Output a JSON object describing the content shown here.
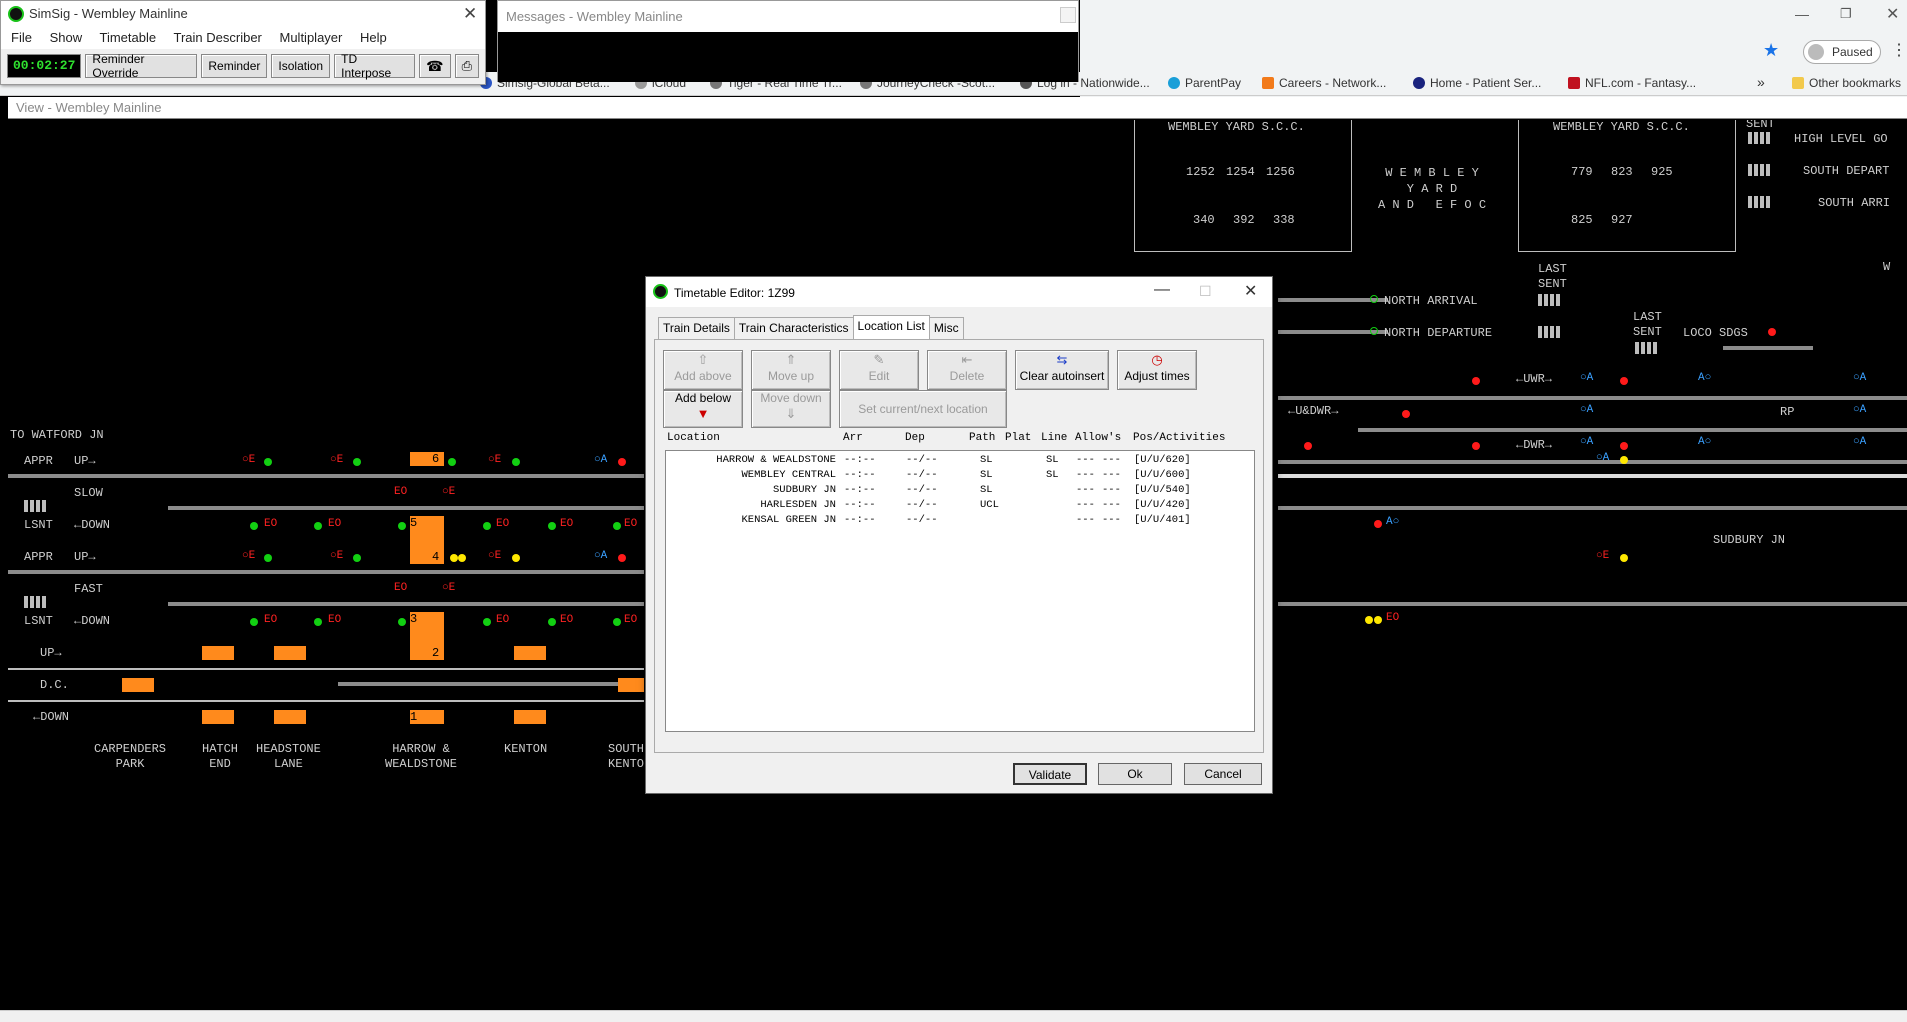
{
  "simsig": {
    "title": "SimSig - Wembley Mainline",
    "menu": [
      "File",
      "Show",
      "Timetable",
      "Train Describer",
      "Multiplayer",
      "Help"
    ],
    "clock": "00:02:27",
    "buttons": [
      "Reminder Override",
      "Reminder",
      "Isolation",
      "TD Interpose"
    ]
  },
  "messages": {
    "title": "Messages - Wembley Mainline"
  },
  "browser": {
    "paused_label": "Paused",
    "bookmarks": [
      "Simsig-Global Beta...",
      "iCloud",
      "Tiger - Real Time Tr...",
      "JourneyCheck -Scot...",
      "Log in - Nationwide...",
      "ParentPay",
      "Careers - Network...",
      "Home - Patient Ser...",
      "NFL.com - Fantasy...",
      "Other bookmarks"
    ],
    "more": "»"
  },
  "view": {
    "title": "View - Wembley Mainline"
  },
  "diagram": {
    "labels": {
      "watford": "TO WATFORD JN",
      "appr1": "APPR",
      "up1": "UP→",
      "slow": "SLOW",
      "lsnt1": "LSNT",
      "down1": "←DOWN",
      "appr2": "APPR",
      "up2": "UP→",
      "fast": "FAST",
      "lsnt2": "LSNT",
      "down2": "←DOWN",
      "up_dc": "UP→",
      "dc": "D.C.",
      "down_dc": "←DOWN",
      "north_arrival": "NORTH ARRIVAL",
      "north_departure": "NORTH DEPARTURE",
      "last_sent1": "LAST\nSENT",
      "last_sent2": "LAST\nSENT",
      "loco_sdgs": "LOCO SDGS",
      "sudbury_jn": "SUDBURY JN",
      "rp": "RP",
      "wembley_yard1": "WEMBLEY YARD S.C.C.",
      "wembley_yard2": "WEMBLEY YARD S.C.C.",
      "wembley_efoc": "W E M B L E Y\nY A R D\nA N D   E F O C",
      "sent": "SENT",
      "high_level": "HIGH LEVEL GO",
      "south_depart": "SOUTH DEPART",
      "south_arri": "SOUTH ARRI",
      "uwr": "←UWR→",
      "udwr": "←U&DWR→",
      "dwr": "←DWR→",
      "w_partial": "W"
    },
    "yard1_numbers": [
      "1252",
      "1254",
      "1256",
      "340",
      "392",
      "338"
    ],
    "yard2_numbers": [
      "779",
      "823",
      "925",
      "825",
      "927"
    ],
    "platforms": [
      "6",
      "5",
      "4",
      "3",
      "2",
      "1"
    ],
    "stations": [
      "CARPENDERS\nPARK",
      "HATCH\nEND",
      "HEADSTONE\nLANE",
      "HARROW &\nWEALDSTONE",
      "KENTON",
      "SOUTH\nKENTO"
    ]
  },
  "editor": {
    "title": "Timetable Editor: 1Z99",
    "tabs": [
      "Train Details",
      "Train Characteristics",
      "Location List",
      "Misc"
    ],
    "active_tab": "Location List",
    "buttons": {
      "add_above": "Add above",
      "move_up": "Move up",
      "edit": "Edit",
      "delete": "Delete",
      "clear_autoinsert": "Clear autoinsert",
      "adjust_times": "Adjust times",
      "add_below": "Add below",
      "move_down": "Move down",
      "set_current": "Set current/next location"
    },
    "columns": [
      "Location",
      "Arr",
      "Dep",
      "Path",
      "Plat",
      "Line",
      "Allow's",
      "Pos/Activities"
    ],
    "rows": [
      {
        "location": "HARROW & WEALDSTONE",
        "arr": "--:--",
        "dep": "--/--",
        "path": "SL",
        "plat": "",
        "line": "SL",
        "allow1": "---",
        "allow2": "---",
        "pos": "[U/U/620]"
      },
      {
        "location": "WEMBLEY CENTRAL",
        "arr": "--:--",
        "dep": "--/--",
        "path": "SL",
        "plat": "",
        "line": "SL",
        "allow1": "---",
        "allow2": "---",
        "pos": "[U/U/600]"
      },
      {
        "location": "SUDBURY JN",
        "arr": "--:--",
        "dep": "--/--",
        "path": "SL",
        "plat": "",
        "line": "",
        "allow1": "---",
        "allow2": "---",
        "pos": "[U/U/540]"
      },
      {
        "location": "HARLESDEN JN",
        "arr": "--:--",
        "dep": "--/--",
        "path": "UCL",
        "plat": "",
        "line": "",
        "allow1": "---",
        "allow2": "---",
        "pos": "[U/U/420]"
      },
      {
        "location": "KENSAL GREEN JN",
        "arr": "--:--",
        "dep": "--/--",
        "path": "",
        "plat": "",
        "line": "",
        "allow1": "---",
        "allow2": "---",
        "pos": "[U/U/401]"
      }
    ],
    "footer": {
      "validate": "Validate",
      "ok": "Ok",
      "cancel": "Cancel"
    }
  },
  "colors": {
    "track": "#8c8c8c",
    "platform": "#ff8a1c",
    "signal_green": "#12d012",
    "signal_red": "#ff1a1a",
    "signal_yellow": "#ffe800",
    "auto_blue": "#1e90ff"
  }
}
